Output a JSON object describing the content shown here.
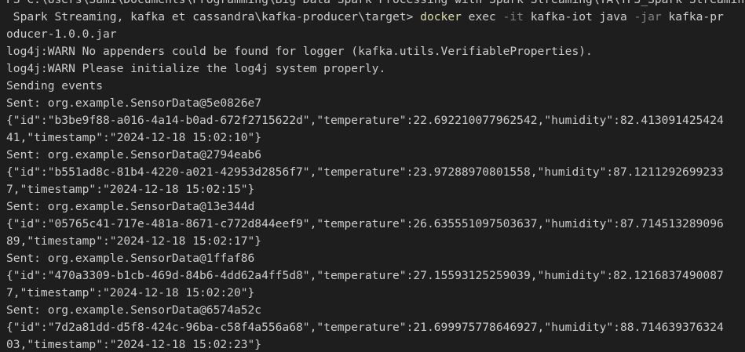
{
  "terminal": {
    "lines": [
      {
        "text": "PS C:\\Users\\Sami\\Documents\\Programming\\Big Data Spark Processing with Spark Streaming\\TA\\TP3_Spark Streaming, kafka et cassandra\\kafka-producer\\target> "
      },
      {
        "prompt": " Spark Streaming, kafka et cassandra\\kafka-producer\\target> ",
        "cmd_docker": "docker",
        "cmd_exec": " exec ",
        "cmd_flag_it": "-it",
        "cmd_container": " kafka-iot java ",
        "cmd_flag_jar": "-jar",
        "cmd_jar_start": " kafka-pr"
      },
      {
        "text": "oducer-1.0.0.jar"
      },
      {
        "text": "log4j:WARN No appenders could be found for logger (kafka.utils.VerifiableProperties)."
      },
      {
        "text": "log4j:WARN Please initialize the log4j system properly."
      },
      {
        "text": "Sending events"
      },
      {
        "text": "Sent: org.example.SensorData@5e0826e7"
      },
      {
        "text": "{\"id\":\"b3be9f88-a016-4a14-b0ad-672f2715622d\",\"temperature\":22.692210077962542,\"humidity\":82.413091425424"
      },
      {
        "text": "41,\"timestamp\":\"2024-12-18 15:02:10\"}"
      },
      {
        "text": "Sent: org.example.SensorData@2794eab6"
      },
      {
        "text": "{\"id\":\"b551ad8c-81b4-4220-a021-42953d2856f7\",\"temperature\":23.97288970801558,\"humidity\":87.1211292699233"
      },
      {
        "text": "7,\"timestamp\":\"2024-12-18 15:02:15\"}"
      },
      {
        "text": "Sent: org.example.SensorData@13e344d"
      },
      {
        "text": "{\"id\":\"05765c41-717e-481a-8671-c772d844eef9\",\"temperature\":26.635551097503637,\"humidity\":87.714513289096"
      },
      {
        "text": "89,\"timestamp\":\"2024-12-18 15:02:17\"}"
      },
      {
        "text": "Sent: org.example.SensorData@1ffaf86"
      },
      {
        "text": "{\"id\":\"470a3309-b1cb-469d-84b6-4dd62a4ff5d8\",\"temperature\":27.15593125259039,\"humidity\":82.1216837490087"
      },
      {
        "text": "7,\"timestamp\":\"2024-12-18 15:02:20\"}"
      },
      {
        "text": "Sent: org.example.SensorData@6574a52c"
      },
      {
        "text": "{\"id\":\"7d2a81dd-d5f8-424c-96ba-c58f4a556a68\",\"temperature\":21.699975778646927,\"humidity\":88.714639376324"
      },
      {
        "text": "03,\"timestamp\":\"2024-12-18 15:02:23\"}"
      }
    ]
  }
}
